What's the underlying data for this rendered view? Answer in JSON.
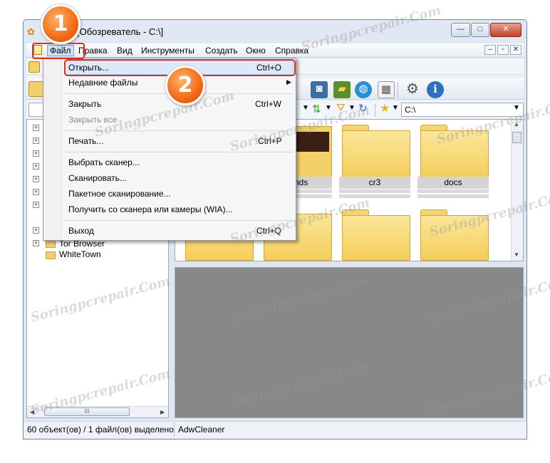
{
  "window": {
    "title": "[Обозреватель - C:\\]",
    "caption_buttons": {
      "minimize": "—",
      "maximize": "□",
      "close": "✕"
    }
  },
  "menubar": {
    "items": [
      "Файл",
      "Правка",
      "Вид",
      "Инструменты",
      "Создать",
      "Окно",
      "Справка"
    ],
    "mdi_buttons": [
      "–",
      "▫",
      "✕"
    ]
  },
  "file_menu": {
    "items": [
      {
        "label": "Открыть...",
        "shortcut": "Ctrl+O",
        "enabled": true
      },
      {
        "label": "Недавние файлы",
        "shortcut": "",
        "enabled": true,
        "submenu": true
      },
      {
        "label": "Закрыть",
        "shortcut": "Ctrl+W",
        "enabled": true
      },
      {
        "label": "Закрыть все",
        "shortcut": "",
        "enabled": false
      },
      {
        "label": "Печать...",
        "shortcut": "Ctrl+P",
        "enabled": true
      },
      {
        "label": "Выбрать сканер...",
        "shortcut": "",
        "enabled": true
      },
      {
        "label": "Сканировать...",
        "shortcut": "",
        "enabled": true
      },
      {
        "label": "Пакетное сканирование...",
        "shortcut": "",
        "enabled": true
      },
      {
        "label": "Получить со сканера или камеры (WIA)...",
        "shortcut": "",
        "enabled": true
      },
      {
        "label": "Выход",
        "shortcut": "Ctrl+Q",
        "enabled": true
      }
    ],
    "submenu_arrow": "▶"
  },
  "toolbar": {
    "address": "C:\\",
    "icons": [
      "camera-icon",
      "monitor-icon",
      "globe-icon",
      "grid-icon",
      "settings-icon",
      "info-icon"
    ]
  },
  "tree": {
    "items": [
      "Tor Browser",
      "WhiteTown"
    ],
    "scroll_grip": "III"
  },
  "files": {
    "items": [
      "ounds",
      "cr3",
      "docs"
    ]
  },
  "status": {
    "count": "60 объект(ов) / 1 файл(ов) выделено",
    "file": "AdwCleaner"
  },
  "annotations": {
    "step1": "1",
    "step2": "2"
  },
  "watermark": "Soringpcrepair.Com"
}
